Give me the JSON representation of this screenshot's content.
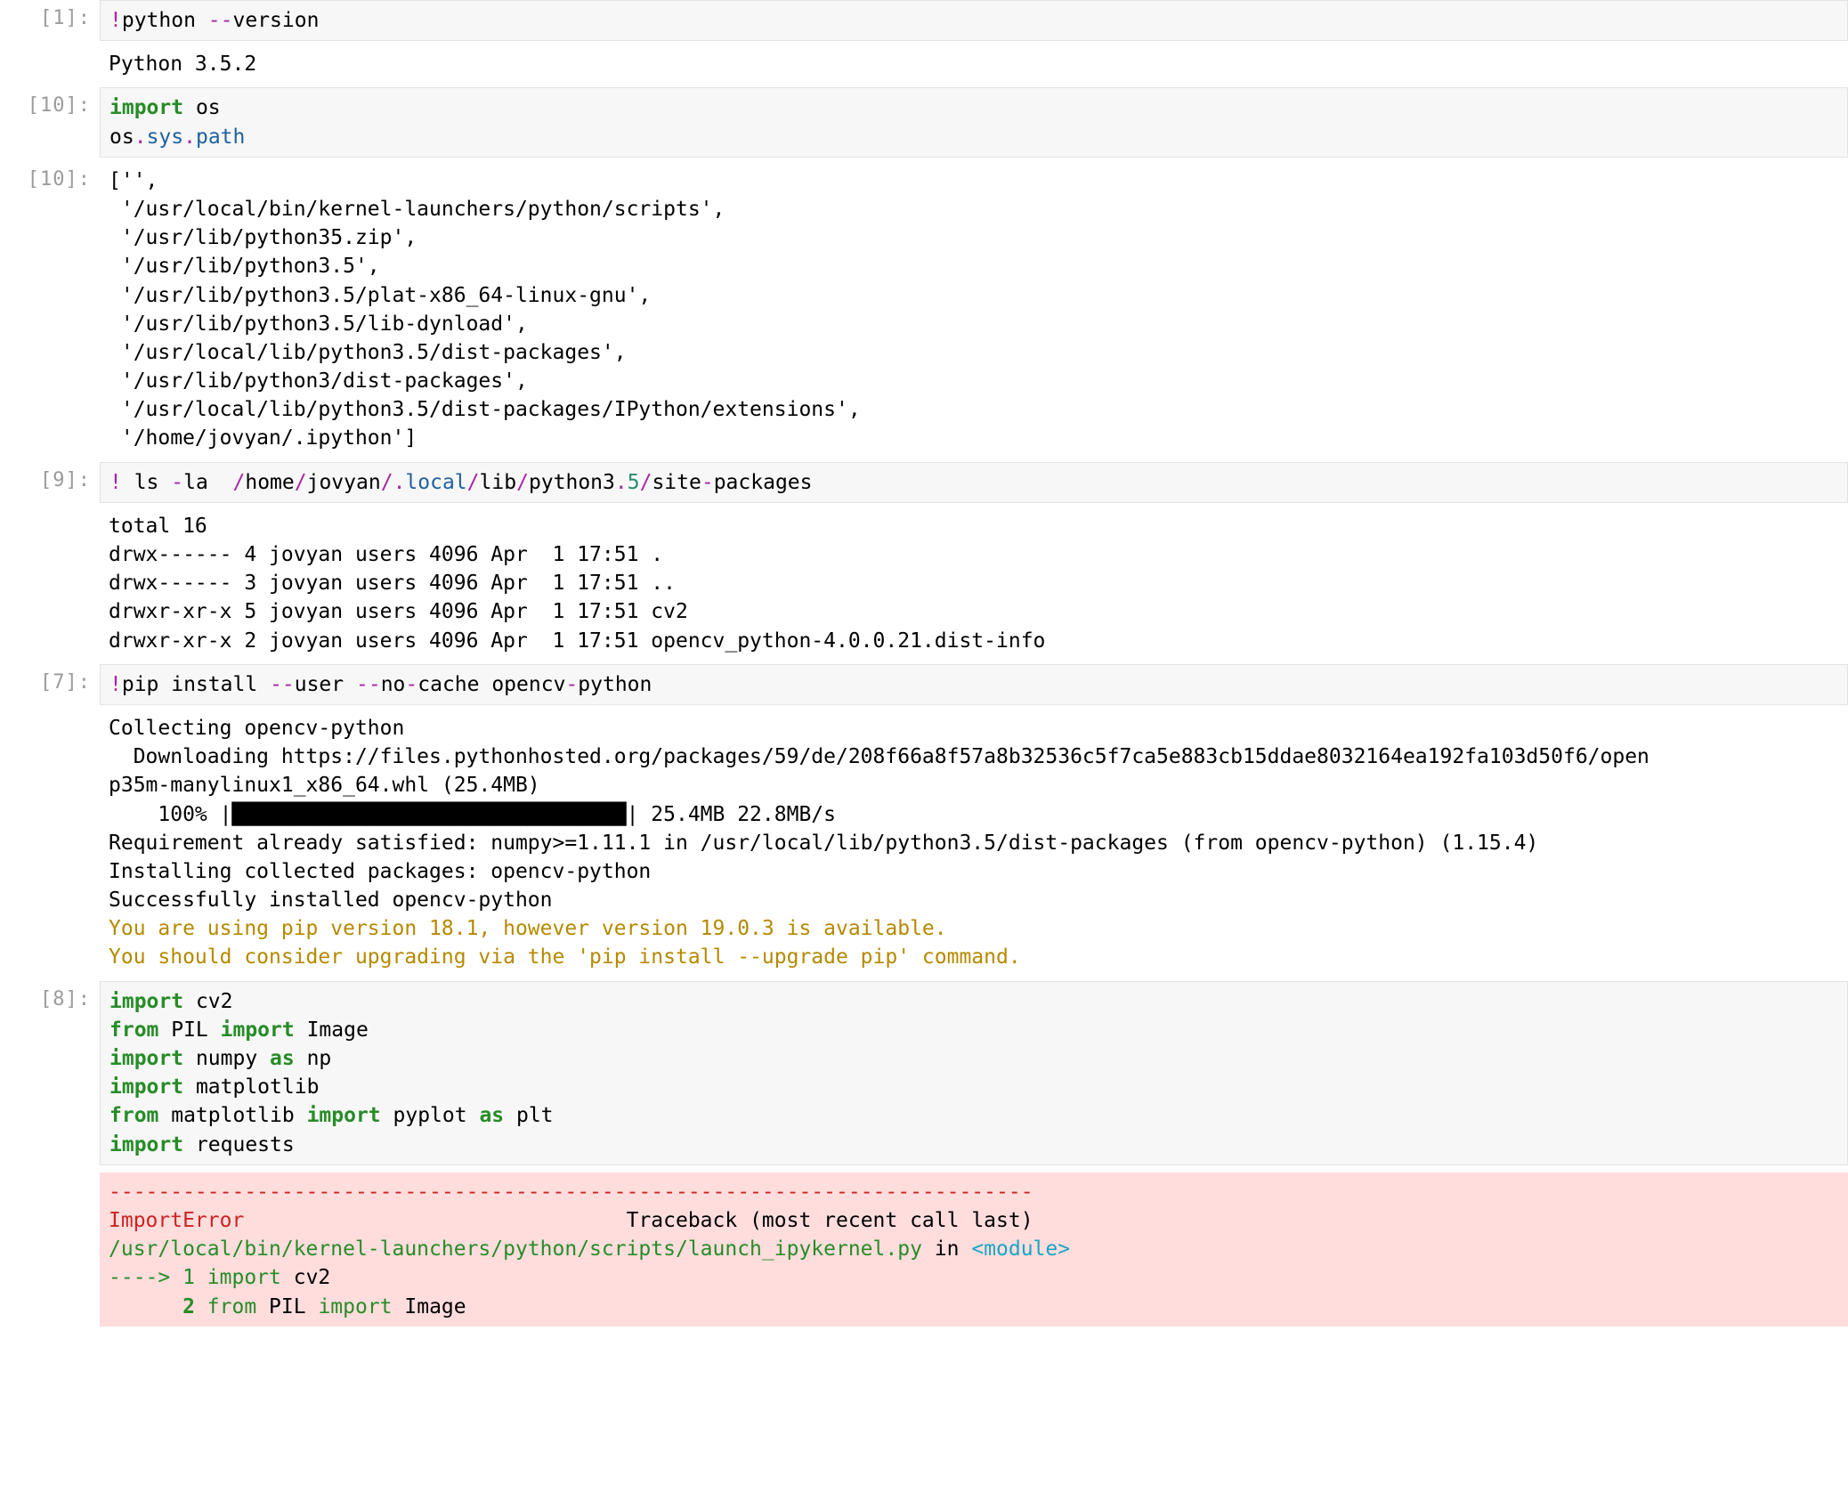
{
  "cells": {
    "c1": {
      "prompt": "[1]:",
      "out_prompt": "",
      "code": {
        "bang": "!",
        "python": "python ",
        "dashdash": "--",
        "version": "version"
      },
      "output": "Python 3.5.2"
    },
    "c2": {
      "prompt": "[10]:",
      "out_prompt": "[10]:",
      "code": {
        "import_kw": "import",
        "os": " os",
        "os2": "os",
        "dot1": ".",
        "sys": "sys",
        "dot2": ".",
        "path": "path"
      },
      "output": "['',\n '/usr/local/bin/kernel-launchers/python/scripts',\n '/usr/lib/python35.zip',\n '/usr/lib/python3.5',\n '/usr/lib/python3.5/plat-x86_64-linux-gnu',\n '/usr/lib/python3.5/lib-dynload',\n '/usr/local/lib/python3.5/dist-packages',\n '/usr/lib/python3/dist-packages',\n '/usr/local/lib/python3.5/dist-packages/IPython/extensions',\n '/home/jovyan/.ipython']"
    },
    "c3": {
      "prompt": "[9]:",
      "code": {
        "bang": "!",
        "ls": " ls ",
        "dash1": "-",
        "la": "la  ",
        "s1": "/",
        "home": "home",
        "s2": "/",
        "jovyan": "jovyan",
        "s3": "/",
        "dot": ".",
        "local": "local",
        "s4": "/",
        "lib": "lib",
        "s5": "/",
        "python3": "python3",
        "dot2": ".",
        "five": "5",
        "s6": "/",
        "site": "site",
        "dash2": "-",
        "packages": "packages"
      },
      "output": "total 16\ndrwx------ 4 jovyan users 4096 Apr  1 17:51 .\ndrwx------ 3 jovyan users 4096 Apr  1 17:51 ..\ndrwxr-xr-x 5 jovyan users 4096 Apr  1 17:51 cv2\ndrwxr-xr-x 2 jovyan users 4096 Apr  1 17:51 opencv_python-4.0.0.21.dist-info"
    },
    "c4": {
      "prompt": "[7]:",
      "code": {
        "bang": "!",
        "pip": "pip install ",
        "dd1": "--",
        "user": "user ",
        "dd2": "--",
        "no": "no",
        "dash3": "-",
        "cache": "cache opencv",
        "dash4": "-",
        "python": "python"
      },
      "out_plain": "Collecting opencv-python\n  Downloading https://files.pythonhosted.org/packages/59/de/208f66a8f57a8b32536c5f7ca5e883cb15ddae8032164ea192fa103d50f6/open\np35m-manylinux1_x86_64.whl (25.4MB)\n    100% |████████████████████████████████| 25.4MB 22.8MB/s\nRequirement already satisfied: numpy>=1.11.1 in /usr/local/lib/python3.5/dist-packages (from opencv-python) (1.15.4)\nInstalling collected packages: opencv-python\nSuccessfully installed opencv-python",
      "out_warn": "You are using pip version 18.1, however version 19.0.3 is available.\nYou should consider upgrading via the 'pip install --upgrade pip' command."
    },
    "c5": {
      "prompt": "[8]:",
      "code": {
        "l1_import": "import",
        "l1_cv2": " cv2",
        "l2_from": "from",
        "l2_pil": " PIL ",
        "l2_import": "import",
        "l2_image": " Image",
        "l3_import": "import",
        "l3_numpy": " numpy ",
        "l3_as": "as",
        "l3_np": " np",
        "l4_import": "import",
        "l4_mpl": " matplotlib",
        "l5_from": "from",
        "l5_mpl": " matplotlib ",
        "l5_import": "import",
        "l5_pyplot": " pyplot ",
        "l5_as": "as",
        "l5_plt": " plt",
        "l6_import": "import",
        "l6_req": " requests"
      },
      "err": {
        "rule": "---------------------------------------------------------------------------",
        "name": "ImportError",
        "spaces": "                               ",
        "trace": "Traceback (most recent call last)",
        "file": "/usr/local/bin/kernel-launchers/python/scripts/launch_ipykernel.py",
        "in": " in ",
        "module": "<module>",
        "arrow": "----> 1 ",
        "l1": "import",
        "l1b": " cv2",
        "sp2": "      ",
        "n2": "2 ",
        "l2a": "from",
        "l2b": " PIL ",
        "l2c": "import",
        "l2d": " Image"
      }
    }
  }
}
